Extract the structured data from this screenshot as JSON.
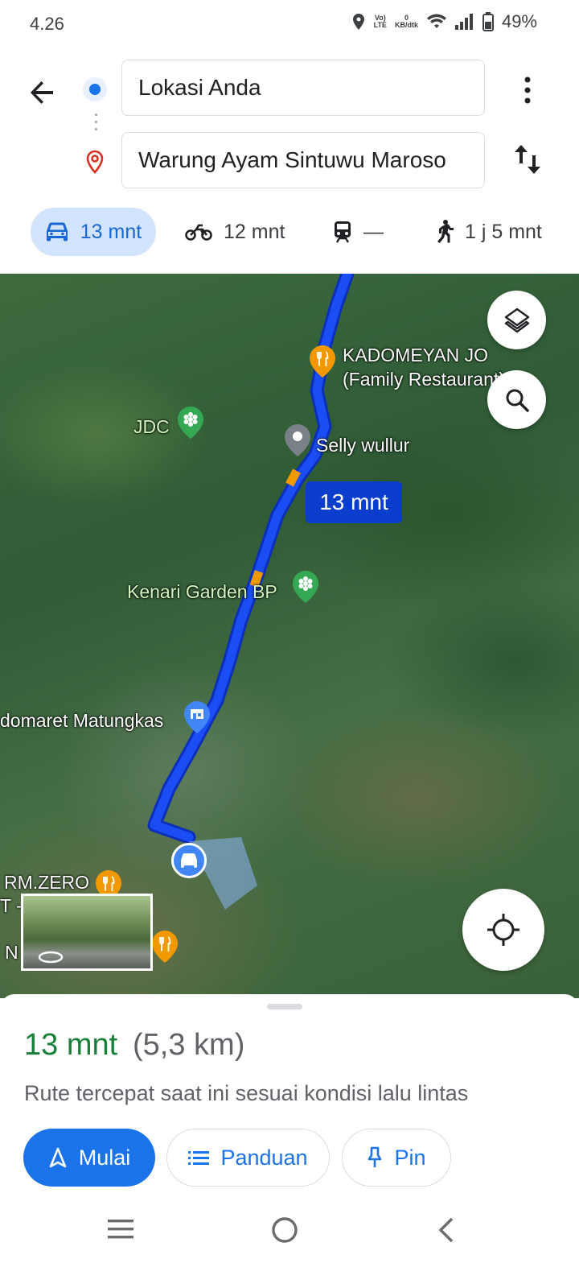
{
  "status_bar": {
    "time": "4.26",
    "volte_top": "Vo)",
    "volte_bottom": "LTE",
    "speed_top": "0",
    "speed_bottom": "KB/dtk",
    "battery": "49%"
  },
  "directions": {
    "origin": "Lokasi Anda",
    "destination": "Warung Ayam Sintuwu Maroso",
    "modes": [
      {
        "icon": "car-icon",
        "label": "13 mnt",
        "active": true
      },
      {
        "icon": "motorcycle-icon",
        "label": "12 mnt",
        "active": false
      },
      {
        "icon": "transit-icon",
        "label": "—",
        "active": false
      },
      {
        "icon": "walk-icon",
        "label": "1 j 5 mnt",
        "active": false
      }
    ]
  },
  "map": {
    "route_color": "#1a4ef4",
    "eta_badge": "13 mnt",
    "places": [
      {
        "name": "KADOMEYAN JO",
        "icon": "restaurant-icon"
      },
      {
        "name": "(Family Restaurant)"
      },
      {
        "name": "JDC",
        "icon": "park-icon"
      },
      {
        "name": "Selly wullur",
        "icon": "pin-icon"
      },
      {
        "name": "Kenari Garden BP",
        "icon": "park-icon"
      },
      {
        "name": "domaret Matungkas",
        "icon": "shop-icon"
      },
      {
        "name": "RM.ZERO",
        "icon": "restaurant-icon"
      },
      {
        "name": "T -"
      },
      {
        "name": "N"
      }
    ]
  },
  "sheet": {
    "eta": "13 mnt",
    "distance": "(5,3 km)",
    "description": "Rute tercepat saat ini sesuai kondisi lalu lintas",
    "buttons": {
      "start": "Mulai",
      "guide": "Panduan",
      "pin": "Pin"
    }
  }
}
